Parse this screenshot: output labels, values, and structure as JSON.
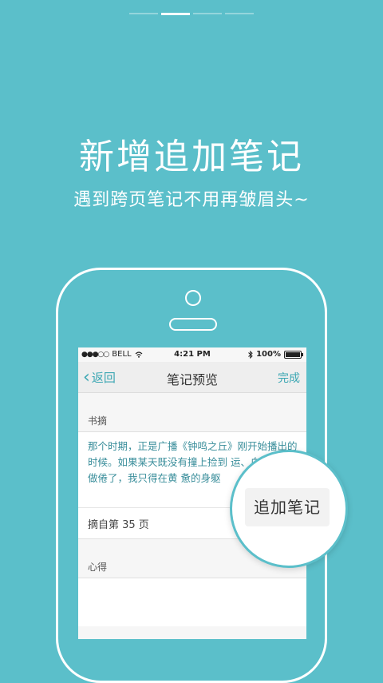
{
  "promo": {
    "headline": "新增追加笔记",
    "subline": "遇到跨页笔记不用再皱眉头~"
  },
  "pager": {
    "count": 4,
    "active_index": 1
  },
  "status_bar": {
    "carrier": "BELL",
    "time": "4:21 PM",
    "battery": "100%",
    "icons": [
      "signal-dots-icon",
      "wifi-icon",
      "bluetooth-icon",
      "battery-icon"
    ]
  },
  "nav_bar": {
    "back_label": "返回",
    "title": "笔记预览",
    "done_label": "完成"
  },
  "excerpt": {
    "label": "书摘",
    "text": "那个时期，正是广播《钟鸣之丘》刚开始播出的时候。如果某天既没有撞上捡到 运、白日梦又做倦了，我只得在黄 惫的身躯",
    "page_note": "摘自第 35 页"
  },
  "notes": {
    "label": "心得"
  },
  "append_button": {
    "label": "追加笔记"
  },
  "colors": {
    "background": "#5bbfca",
    "accent": "#3ca7b3",
    "quote_text": "#3a8e9b"
  }
}
